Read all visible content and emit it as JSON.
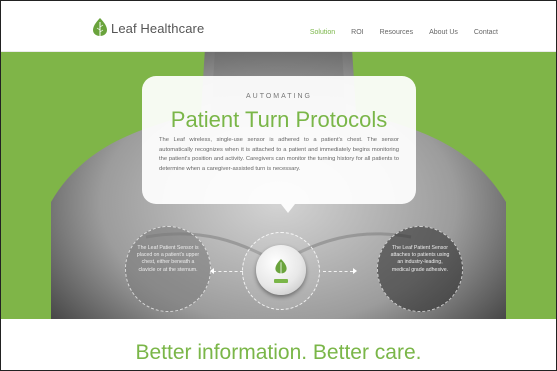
{
  "header": {
    "logo_text": "Leaf Healthcare",
    "nav": [
      {
        "label": "Solution",
        "active": true
      },
      {
        "label": "ROI",
        "active": false
      },
      {
        "label": "Resources",
        "active": false
      },
      {
        "label": "About Us",
        "active": false
      },
      {
        "label": "Contact",
        "active": false
      }
    ]
  },
  "hero": {
    "eyebrow": "AUTOMATING",
    "title": "Patient Turn Protocols",
    "description": "The Leaf wireless, single-use sensor is adhered to a patient's chest. The sensor automatically recognizes when it is attached to a patient and immediately begins monitoring the patient's position and activity. Caregivers can monitor the turning history for all patients to determine when a caregiver-assisted turn is necessary.",
    "left_callout": "The Leaf Patient Sensor is placed on a patient's upper chest, either beneath a clavicle or at the sternum.",
    "right_callout": "The Leaf Patient Sensor attaches to patients using an industry-leading, medical grade adhesive."
  },
  "tagline": "Better information. Better care.",
  "colors": {
    "brand_green": "#7ab648",
    "hero_bg": "#7fb548"
  },
  "icons": {
    "logo": "leaf-icon",
    "sensor": "sensor-device-icon"
  }
}
